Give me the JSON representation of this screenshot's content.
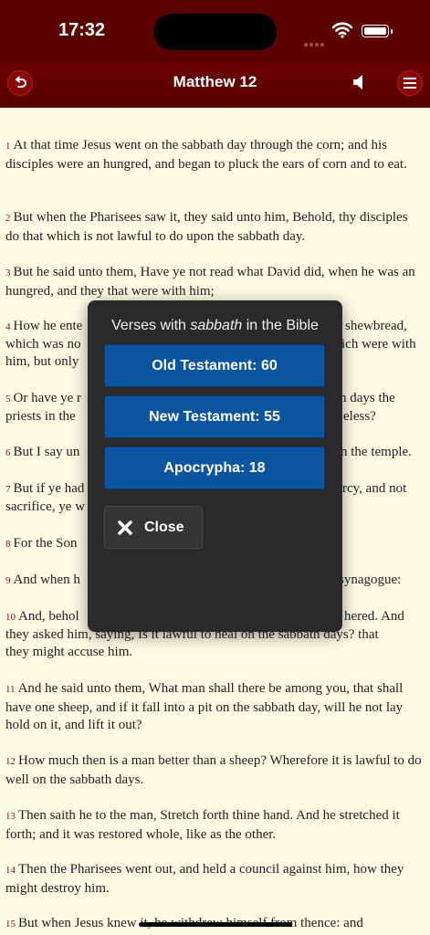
{
  "status": {
    "time": "17:32"
  },
  "navbar": {
    "title": "Matthew 12"
  },
  "verses": [
    {
      "num": "1",
      "text": "At that time Jesus went on the sabbath day through the corn; and his disciples were an hungred, and began to pluck the ears of corn and to eat."
    },
    {
      "num": "2",
      "text": "But when the Pharisees saw it, they said unto him, Behold, thy disciples do that which is not lawful to do upon the sabbath day."
    },
    {
      "num": "3",
      "text": "But he said unto them, Have ye not read what David did, when he was an hungred, and they that were with him;"
    },
    {
      "num": "4",
      "text": "How he ente",
      "text2": "which was no",
      "text3": "him, but only",
      "text_right": "shewbread,",
      "text2_right": "ich were with"
    },
    {
      "num": "5",
      "text": "Or have ye r",
      "text2": "priests in the",
      "text_right": "n days the",
      "text2_right": "eless?"
    },
    {
      "num": "6",
      "text": "But I say un",
      "text_right": "n the temple."
    },
    {
      "num": "7",
      "text": "But if ye had",
      "text2": "sacrifice, ye w",
      "text_right": "rcy, and not"
    },
    {
      "num": "8",
      "text": "For the Son"
    },
    {
      "num": "9",
      "text": "And when h",
      "text_right": "synagogue:"
    },
    {
      "num": "10",
      "text": "And, behol",
      "text_right": "hered. And",
      "text2": "they asked him, saying, Is it lawful to heal on the sabbath days? that",
      "text3": "they might accuse him."
    },
    {
      "num": "11",
      "text": "And he said unto them, What man shall there be among you, that shall have one sheep, and if it fall into a pit on the sabbath day, will he not lay hold on it, and lift it out?"
    },
    {
      "num": "12",
      "text": "How much then is a man better than a sheep? Wherefore it is lawful to do well on the sabbath days."
    },
    {
      "num": "13",
      "text": "Then saith he to the man, Stretch forth thine hand. And he stretched it forth; and it was restored whole, like as the other."
    },
    {
      "num": "14",
      "text": "Then the Pharisees went out, and held a council against him, how they might destroy him."
    },
    {
      "num": "15",
      "text": "But when Jesus knew it, he withdrew himself from thence: and"
    }
  ],
  "popup": {
    "title_prefix": "Verses with ",
    "title_word": "sabbath",
    "title_suffix": " in the Bible",
    "buttons": [
      {
        "label": "Old Testament: 60"
      },
      {
        "label": "New Testament: 55"
      },
      {
        "label": "Apocrypha: 18"
      }
    ],
    "close_label": "Close"
  }
}
